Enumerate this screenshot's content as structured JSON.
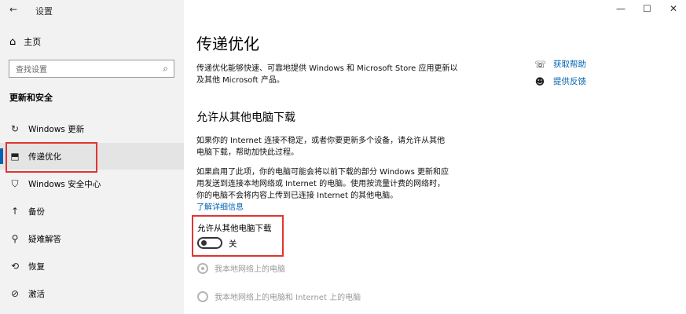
{
  "titlebar": {
    "app_title": "设置",
    "back_icon": "back-arrow-icon",
    "minimize_icon": "minimize-icon",
    "maximize_icon": "maximize-icon",
    "close_icon": "close-icon"
  },
  "sidebar": {
    "home_label": "主页",
    "search_placeholder": "查找设置",
    "section_title": "更新和安全",
    "items": [
      {
        "label": "Windows 更新",
        "icon": "refresh-icon"
      },
      {
        "label": "传递优化",
        "icon": "delivery-icon",
        "selected": true
      },
      {
        "label": "Windows 安全中心",
        "icon": "shield-icon"
      },
      {
        "label": "备份",
        "icon": "backup-icon"
      },
      {
        "label": "疑难解答",
        "icon": "wrench-icon"
      },
      {
        "label": "恢复",
        "icon": "recovery-icon"
      },
      {
        "label": "激活",
        "icon": "activation-icon"
      }
    ]
  },
  "main": {
    "title": "传递优化",
    "intro_line1": "传递优化能够快速、可靠地提供 Windows 和 Microsoft Store 应用更新以",
    "intro_line2": "及其他 Microsoft 产品。",
    "subtitle": "允许从其他电脑下载",
    "para1_line1": "如果你的 Internet 连接不稳定，或者你要更新多个设备，请允许从其他",
    "para1_line2": "电脑下载，帮助加快此过程。",
    "para2_line1": "如果启用了此项，你的电脑可能会将以前下载的部分 Windows 更新和应",
    "para2_line2": "用发送到连接本地网络或 Internet 的电脑。使用按流量计费的网络时，",
    "para2_line3": "你的电脑不会将内容上传到已连接 Internet 的其他电脑。",
    "learn_more": "了解详细信息",
    "toggle_label": "允许从其他电脑下载",
    "toggle_state": "关",
    "radio1": "我本地网络上的电脑",
    "radio2": "我本地网络上的电脑和 Internet 上的电脑"
  },
  "help": {
    "get_help": "获取帮助",
    "feedback": "提供反馈"
  },
  "colors": {
    "accent": "#0063b1",
    "highlight_border": "#e0352f",
    "sidebar_bg": "#f2f2f2"
  }
}
